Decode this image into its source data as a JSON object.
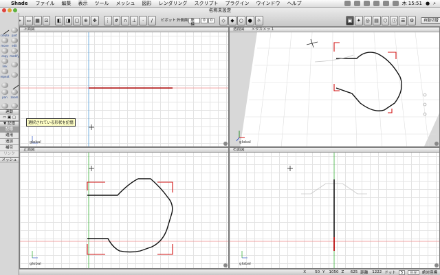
{
  "menubar": {
    "apple": "",
    "app": "Shade",
    "items": [
      "ファイル",
      "編集",
      "表示",
      "ツール",
      "メッシュ",
      "図形",
      "レンダリング",
      "スクリプト",
      "プラグイン",
      "ウインドウ",
      "ヘルプ"
    ],
    "clock": "木 15:51"
  },
  "window": {
    "title": "名称未設定"
  },
  "toolbar": {
    "pivot_label": "ピボット",
    "pivot_field": "座標",
    "pivot_value": "0",
    "pivot_mode": "外側面",
    "pivot_value2": "0",
    "auto_switch": "自動切替",
    "split": "分割"
  },
  "tools": {
    "items": [
      "create",
      "part",
      "move",
      "edit",
      "copy",
      "modify",
      "link",
      "",
      "repeat",
      "",
      "",
      "",
      "pan",
      "zoom"
    ],
    "panel": {
      "head1": "連動",
      "head2": "▼ 記憶",
      "items": [
        "記憶",
        "適用",
        "追加",
        "補引",
        "リンク"
      ],
      "head3": "メッシュ"
    },
    "tooltip": "選択されている形状を記憶"
  },
  "views": {
    "top": {
      "title": "上面図",
      "foot": "global"
    },
    "persp": {
      "title": "透視図",
      "camera": "メタカメラ 1",
      "foot": "global"
    },
    "front": {
      "title": "正面図",
      "foot": "global"
    },
    "side": {
      "title": "右面図",
      "foot": "global"
    }
  },
  "statusbar": {
    "x_label": "X",
    "x": "50",
    "y_label": "Y",
    "y": "1050",
    "z_label": "Z",
    "z": "625",
    "dist_label": "距離",
    "dist": "1222",
    "dot_label": "ドット",
    "dot": "5",
    "unit": "mm",
    "coord": "絶対座標"
  },
  "colors": {
    "red": "#d11010",
    "green": "#1ea81e",
    "curve": "#111111"
  }
}
